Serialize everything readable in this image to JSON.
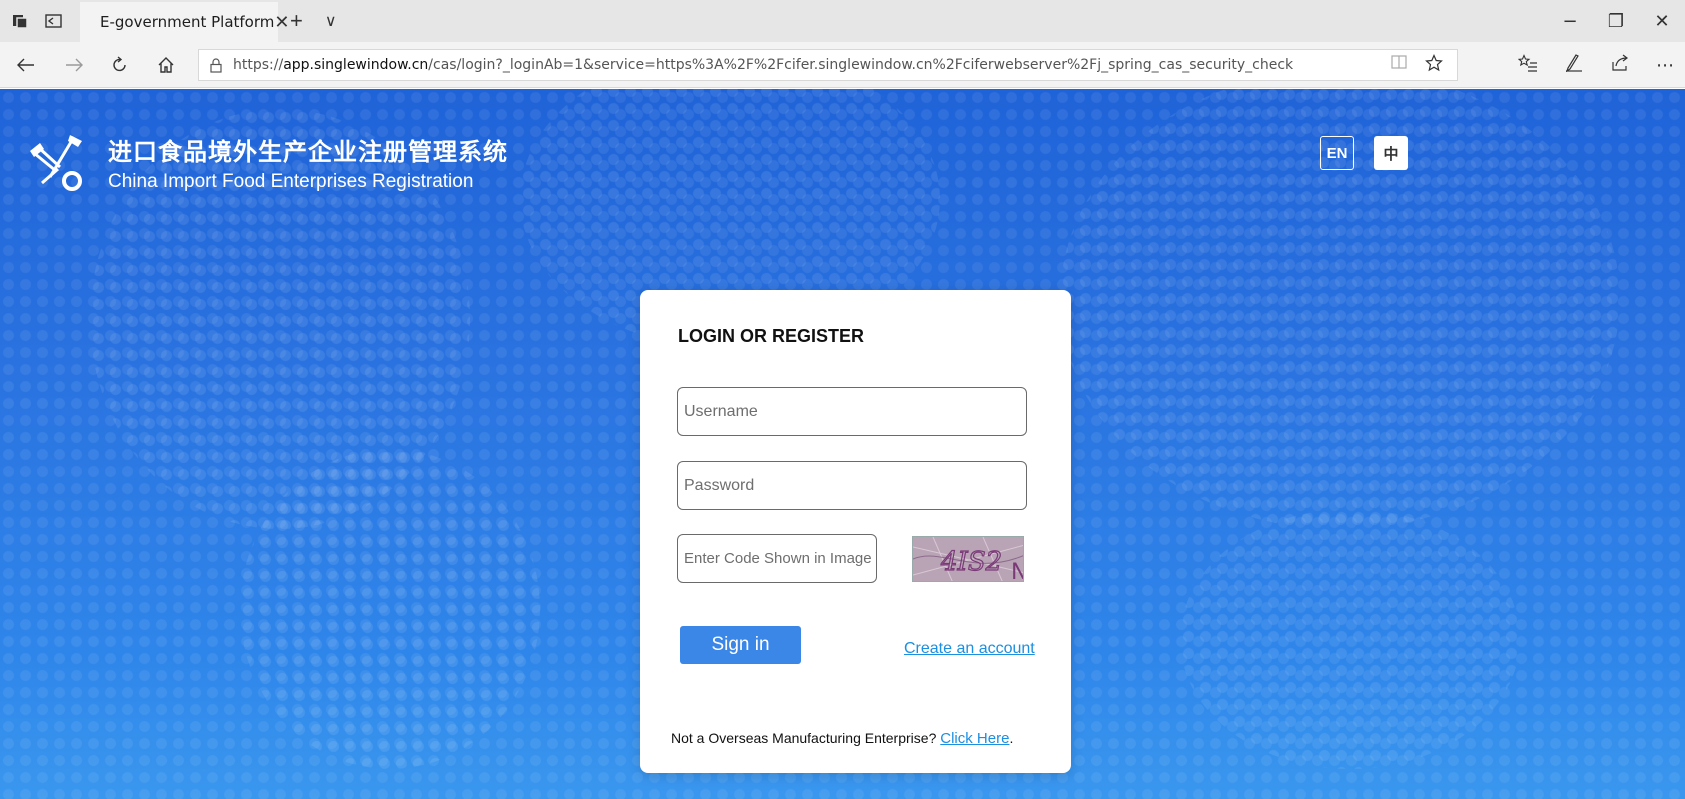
{
  "browser": {
    "tab": {
      "title": "E-government Platform",
      "close": "✕"
    },
    "new_tab": "+",
    "tab_list": "∨",
    "window": {
      "minimize": "−",
      "restore": "❐",
      "close": "✕"
    },
    "url": {
      "prefix": "https://",
      "host": "app.singlewindow.cn",
      "path": "/cas/login?_loginAb=1&service=https%3A%2F%2Fcifer.singlewindow.cn%2Fciferwebserver%2Fj_spring_cas_security_check"
    },
    "icons": [
      "back-icon",
      "forward-icon",
      "refresh-icon",
      "home-icon",
      "lock-icon",
      "reading-view-icon",
      "favorite-star-icon",
      "favorites-list-icon",
      "pen-icon",
      "share-icon",
      "more-icon"
    ]
  },
  "brand": {
    "title_cn": "进口食品境外生产企业注册管理系统",
    "title_en": "China Import Food Enterprises Registration"
  },
  "lang": {
    "en": "EN",
    "cn": "中"
  },
  "login": {
    "title": "LOGIN OR REGISTER",
    "username_placeholder": "Username",
    "password_placeholder": "Password",
    "code_placeholder": "Enter Code Shown in Image",
    "captcha_text": "4IS2",
    "sign_in": "Sign in",
    "create_account": "Create an account",
    "footer_text": "Not a Overseas Manufacturing Enterprise? ",
    "footer_link": "Click Here",
    "footer_end": "."
  },
  "colors": {
    "background_top": "#1f63d8",
    "background_bottom": "#3a97ee",
    "button": "#3a87e8",
    "link": "#1b8fe0"
  }
}
